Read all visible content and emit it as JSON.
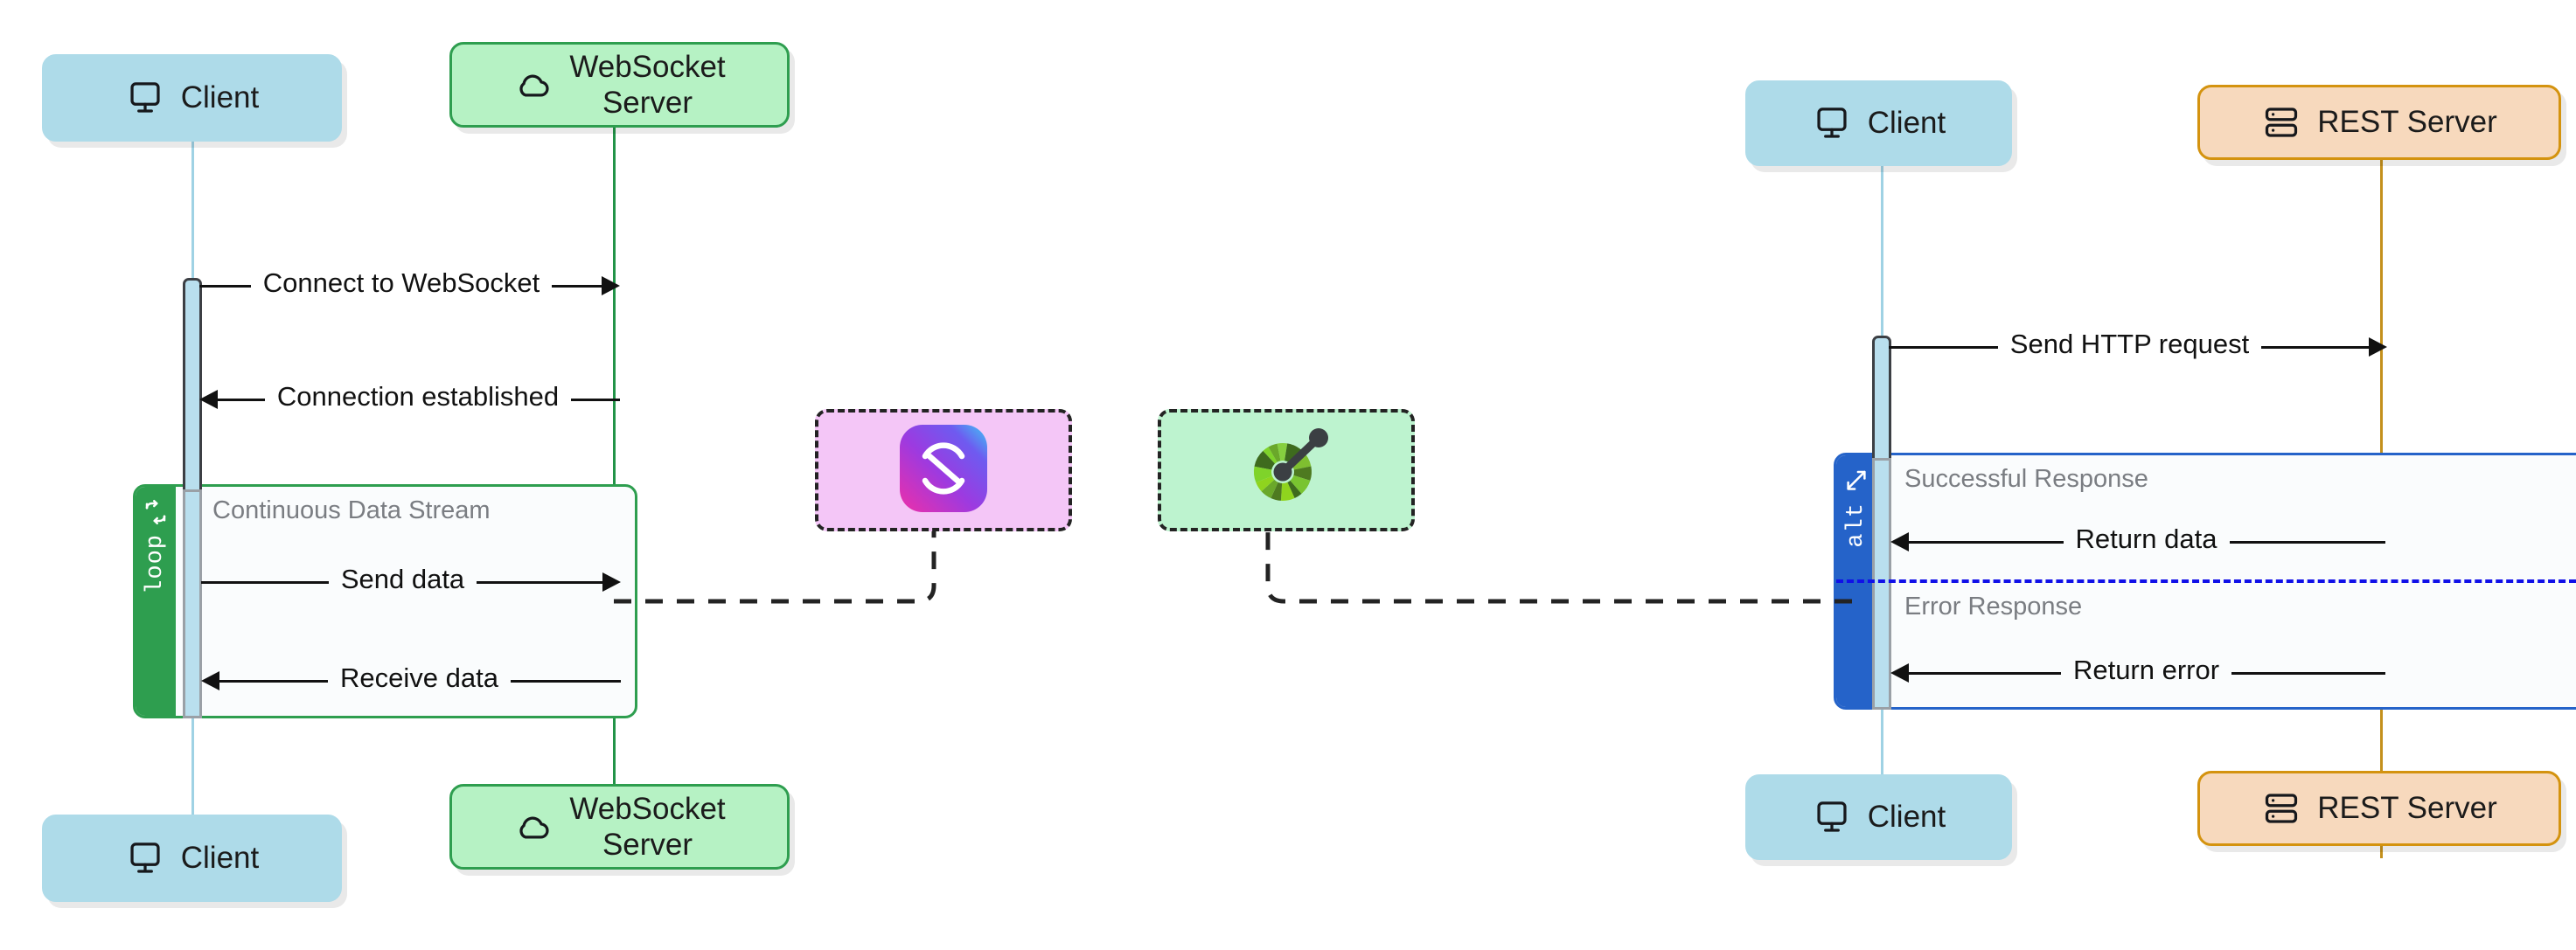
{
  "diagrams": [
    {
      "id": "websocket",
      "participants": [
        {
          "name": "client-top",
          "label": "Client",
          "icon": "monitor-icon",
          "style": "client"
        },
        {
          "name": "wsserver-top",
          "label": "WebSocket\nServer",
          "icon": "cloud-icon",
          "style": "wsserver"
        },
        {
          "name": "client-bottom",
          "label": "Client",
          "icon": "monitor-icon",
          "style": "client"
        },
        {
          "name": "wsserver-bottom",
          "label": "WebSocket\nServer",
          "icon": "cloud-icon",
          "style": "wsserver"
        }
      ],
      "messages": [
        {
          "name": "connect-to-websocket",
          "text": "Connect to WebSocket",
          "direction": "right"
        },
        {
          "name": "connection-established",
          "text": "Connection established",
          "direction": "left"
        },
        {
          "name": "send-data",
          "text": "Send data",
          "direction": "right"
        },
        {
          "name": "receive-data",
          "text": "Receive data",
          "direction": "left"
        }
      ],
      "fragment": {
        "name": "loop-fragment",
        "kind": "loop",
        "tab_label": "loop",
        "tab_icon": "refresh-loop-icon",
        "title": "Continuous Data Stream",
        "accent": "#2e9e4f"
      },
      "note": {
        "name": "socket-io-note",
        "icon": "socket-gradient-logo-icon",
        "background": "#f4c6f7"
      }
    },
    {
      "id": "rest",
      "participants": [
        {
          "name": "client-top",
          "label": "Client",
          "icon": "monitor-icon",
          "style": "client"
        },
        {
          "name": "restserver-top",
          "label": "REST Server",
          "icon": "server-rack-icon",
          "style": "restserver"
        },
        {
          "name": "client-bottom",
          "label": "Client",
          "icon": "monitor-icon",
          "style": "client"
        },
        {
          "name": "restserver-bottom",
          "label": "REST Server",
          "icon": "server-rack-icon",
          "style": "restserver"
        }
      ],
      "messages": [
        {
          "name": "send-http-request",
          "text": "Send HTTP request",
          "direction": "right"
        },
        {
          "name": "return-data",
          "text": "Return data",
          "direction": "left"
        },
        {
          "name": "return-error",
          "text": "Return error",
          "direction": "left"
        }
      ],
      "fragment": {
        "name": "alt-fragment",
        "kind": "alt",
        "tab_label": "alt",
        "tab_icon": "branch-arrows-icon",
        "title": "Successful Response",
        "title_alt": "Error Response",
        "accent": "#2563c9",
        "divider_color": "#1010e8"
      },
      "note": {
        "name": "gauge-note",
        "icon": "gauge-speedometer-icon",
        "background": "#bdf3cf"
      }
    }
  ],
  "colors": {
    "client_fill": "#aedbe9",
    "wsserver_fill": "#b6f2c4",
    "wsserver_border": "#2e9e4f",
    "restserver_fill": "#f7d9bd",
    "restserver_border": "#d4930f",
    "activation_fill": "#b9dfee",
    "activation_border": "#3c3f44",
    "loop_accent": "#2e9e4f",
    "alt_accent": "#2563c9",
    "fragment_body": "#fafcfd",
    "note_pink": "#f4c6f7",
    "note_green": "#bdf3cf",
    "message_line": "#111111",
    "fragment_title_text": "#7a7d82"
  }
}
